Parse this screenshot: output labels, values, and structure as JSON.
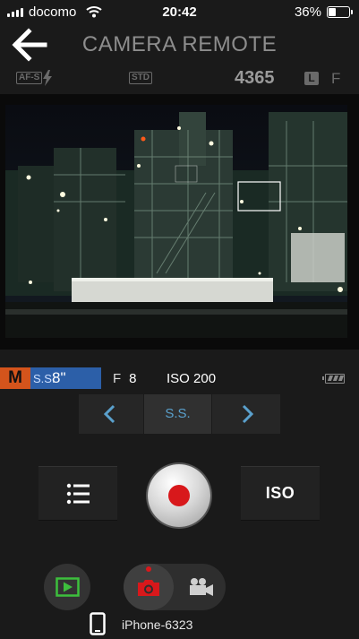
{
  "status_bar": {
    "carrier": "docomo",
    "time": "20:42",
    "battery_percent": "36%",
    "signal_bars": 4,
    "battery_level": 0.36
  },
  "header": {
    "title": "CAMERA REMOTE",
    "back_icon": "arrow-left-icon"
  },
  "info_strip": {
    "focus_mode": "AF-S",
    "flash_icon": "flash-icon",
    "mode_chip": "STD",
    "shots_remaining": "4365",
    "image_size": "L",
    "quality": "F"
  },
  "exposure": {
    "mode": "M",
    "shutter_label": "S.S.",
    "shutter_value": "8\"",
    "aperture_label": "F",
    "aperture_value": "8",
    "iso_label": "ISO",
    "iso_value": "200",
    "camera_battery_icon": "camera-battery-icon"
  },
  "selector": {
    "current": "S.S.",
    "prev_icon": "chevron-left-icon",
    "next_icon": "chevron-right-icon"
  },
  "controls": {
    "menu_icon": "menu-list-icon",
    "iso_button": "ISO",
    "shutter_icon": "shutter-icon"
  },
  "bottom": {
    "playback_icon": "play-icon",
    "photo_icon": "camera-icon",
    "movie_icon": "movie-camera-icon",
    "device_icon": "phone-icon",
    "device_name": "iPhone-6323"
  },
  "colors": {
    "mode_badge": "#d4541c",
    "shutter_highlight": "#2c5fa8",
    "record": "#d8181b",
    "accent": "#5aa0cc",
    "playback": "#3dbf3d"
  }
}
